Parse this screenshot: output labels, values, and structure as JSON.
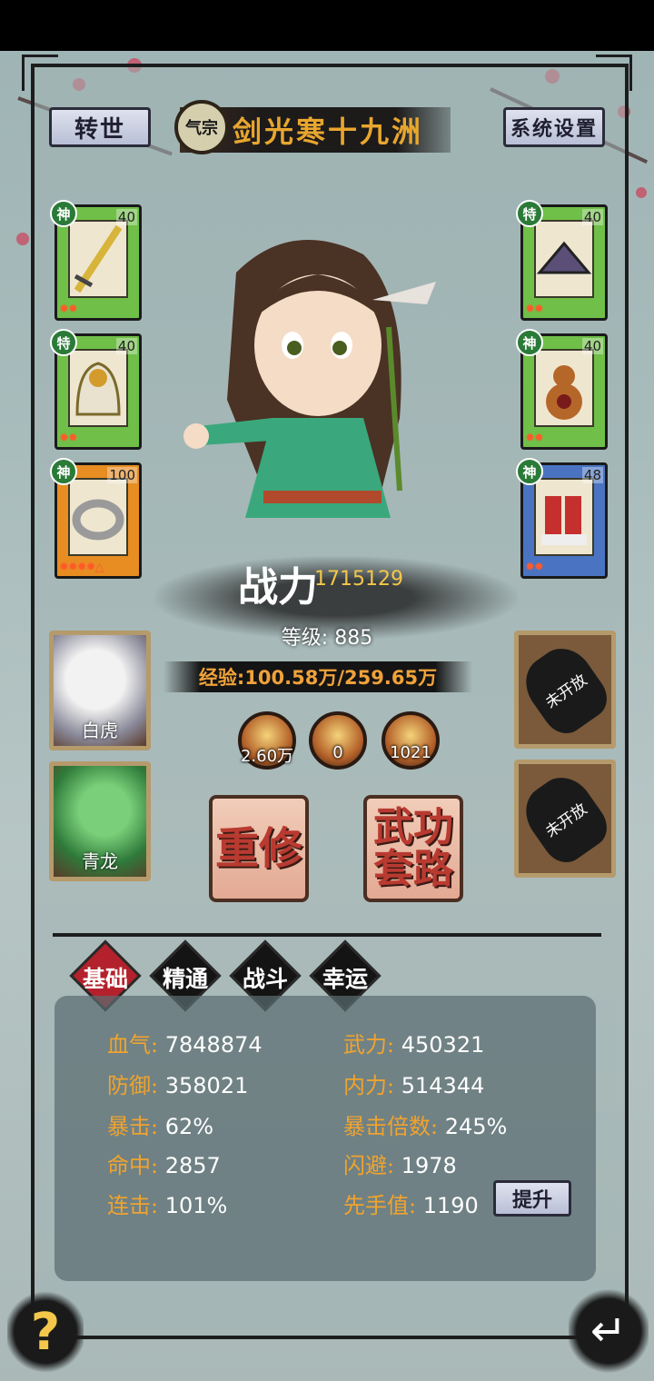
{
  "top": {
    "rebirth_label": "转世",
    "sect_badge": "气宗",
    "title": "剑光寒十九洲",
    "settings_label": "系统设置"
  },
  "equipment_left": [
    {
      "tag": "神",
      "level": "40",
      "stars": "✹✹",
      "color": "green",
      "icon": "sword-icon"
    },
    {
      "tag": "特",
      "level": "40",
      "stars": "✹✹",
      "color": "green",
      "icon": "helmet-icon"
    },
    {
      "tag": "神",
      "level": "100",
      "stars": "✹✹✹✹△",
      "color": "orange",
      "icon": "ring-icon"
    }
  ],
  "equipment_right": [
    {
      "tag": "特",
      "level": "40",
      "stars": "✹✹",
      "color": "green",
      "icon": "hat-icon"
    },
    {
      "tag": "神",
      "level": "40",
      "stars": "✹✹",
      "color": "green",
      "icon": "gourd-icon"
    },
    {
      "tag": "神",
      "level": "48",
      "stars": "✹✹",
      "color": "blue",
      "icon": "boots-icon"
    }
  ],
  "power": {
    "label": "战力",
    "value": "1715129"
  },
  "level": {
    "label": "等级:",
    "value": "885"
  },
  "exp": {
    "text": "经验:100.58万/259.65万"
  },
  "pets": [
    {
      "name": "白虎",
      "icon": "white-tiger-icon"
    },
    {
      "name": "青龙",
      "icon": "azure-dragon-icon"
    }
  ],
  "locked_slots": [
    "未开放",
    "未开放"
  ],
  "orbs": [
    "2.60万",
    "0",
    "1021"
  ],
  "actions": {
    "retrain": "重修",
    "martial": "武功套路"
  },
  "tabs": [
    "基础",
    "精通",
    "战斗",
    "幸运"
  ],
  "stats": {
    "hp": {
      "k": "血气:",
      "v": "7848874"
    },
    "atk": {
      "k": "武力:",
      "v": "450321"
    },
    "def": {
      "k": "防御:",
      "v": "358021"
    },
    "inner": {
      "k": "内力:",
      "v": "514344"
    },
    "crit": {
      "k": "暴击:",
      "v": "62%"
    },
    "critmul": {
      "k": "暴击倍数:",
      "v": "245%"
    },
    "hit": {
      "k": "命中:",
      "v": "2857"
    },
    "dodge": {
      "k": "闪避:",
      "v": "1978"
    },
    "combo": {
      "k": "连击:",
      "v": "101%"
    },
    "initiative": {
      "k": "先手值:",
      "v": "1190"
    }
  },
  "upgrade_label": "提升",
  "help_glyph": "?",
  "back_glyph": "↵"
}
